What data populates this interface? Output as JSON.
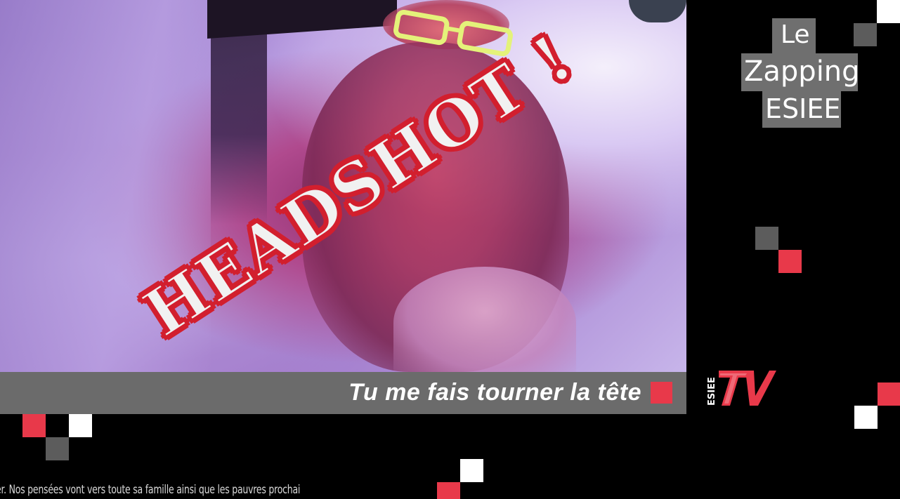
{
  "video": {
    "overlay_stamp": "HEADSHOT !"
  },
  "caption": {
    "text": "Tu me fais tourner la tête"
  },
  "logo": {
    "line1": "Le",
    "line2": "Zapping",
    "line3": "ESIEE"
  },
  "tv_logo": {
    "small_text": "ESIEE",
    "big_text": "TV"
  },
  "ticker": {
    "text": "er. Nos pensées vont vers toute sa famille ainsi que les pauvres prochai"
  },
  "colors": {
    "accent_red": "#e8394a",
    "stamp_red": "#d21f2e",
    "caption_gray": "#6b6b6b",
    "logo_gray": "#6f6f6f",
    "background": "#000000"
  }
}
